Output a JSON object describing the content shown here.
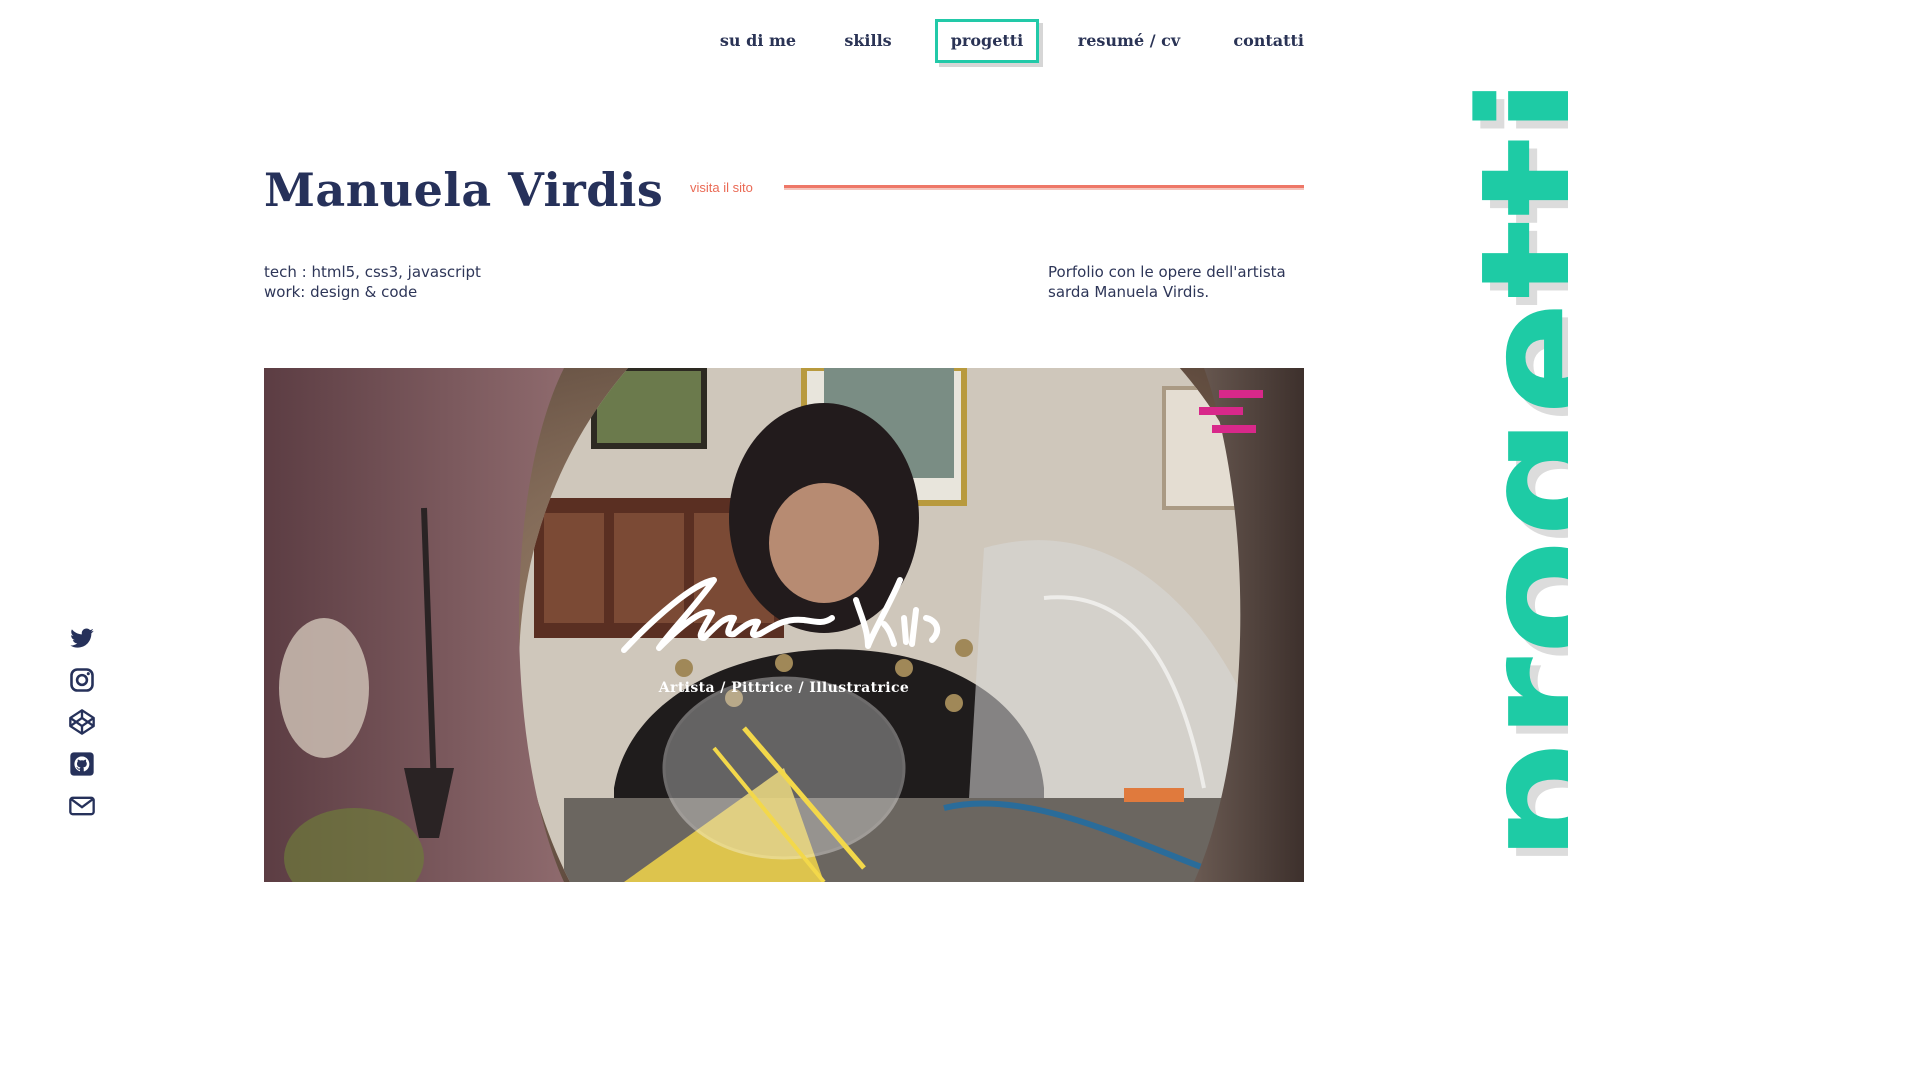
{
  "nav": {
    "items": [
      {
        "label": "su di me"
      },
      {
        "label": "skills"
      },
      {
        "label": "progetti"
      },
      {
        "label": "resumé / cv"
      },
      {
        "label": "contatti"
      }
    ]
  },
  "project": {
    "title": "Manuela Virdis",
    "visit_label": "visita il sito",
    "tech": "tech : html5, css3, javascript",
    "work": "work: design & code",
    "description_line1": "Porfolio con le opere dell'artista",
    "description_line2": "sarda Manuela Virdis.",
    "hero_subtitle": "Artista / Pittrice / Illustratrice"
  },
  "section": {
    "vertical_title": "progetti"
  },
  "social": {
    "icons": [
      "twitter-icon",
      "instagram-icon",
      "codepen-icon",
      "github-icon",
      "mail-icon"
    ]
  },
  "colors": {
    "accent": "#1ecba5",
    "navy": "#26315a",
    "coral": "#ee7767",
    "magenta": "#d8288a"
  }
}
